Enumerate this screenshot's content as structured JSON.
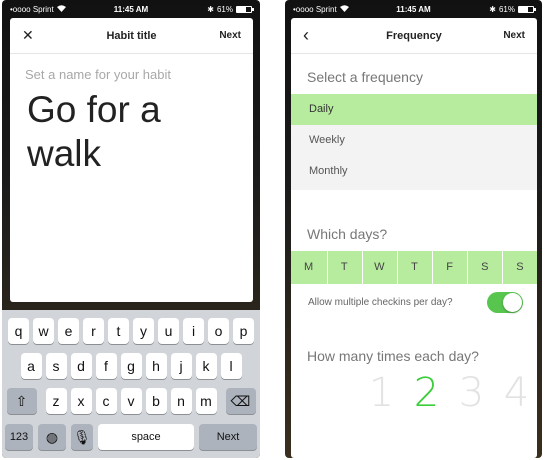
{
  "status_bar": {
    "carrier": "•oooo Sprint",
    "wifi": "wifi-icon",
    "time": "11:45 AM",
    "battery": "61%"
  },
  "left_screen": {
    "nav": {
      "close_icon": "✕",
      "title": "Habit title",
      "next_label": "Next"
    },
    "placeholder": "Set a name for your habit",
    "habit_title": "Go for a walk",
    "keyboard": {
      "row1": [
        "q",
        "w",
        "e",
        "r",
        "t",
        "y",
        "u",
        "i",
        "o",
        "p"
      ],
      "row2": [
        "a",
        "s",
        "d",
        "f",
        "g",
        "h",
        "j",
        "k",
        "l"
      ],
      "row3": [
        "z",
        "x",
        "c",
        "v",
        "b",
        "n",
        "m"
      ],
      "numbers_key": "123",
      "space_key": "space",
      "next_key": "Next"
    }
  },
  "right_screen": {
    "nav": {
      "back_icon": "‹",
      "title": "Frequency",
      "next_label": "Next"
    },
    "frequency_label": "Select a frequency",
    "frequencies": [
      {
        "label": "Daily",
        "selected": true
      },
      {
        "label": "Weekly",
        "selected": false
      },
      {
        "label": "Monthly",
        "selected": false
      }
    ],
    "days_label": "Which days?",
    "days": [
      "M",
      "T",
      "W",
      "T",
      "F",
      "S",
      "S"
    ],
    "multiple_checkins_label": "Allow multiple checkins per day?",
    "multiple_checkins_enabled": true,
    "times_label": "How many times each day?",
    "times_options": [
      "1",
      "2",
      "3",
      "4"
    ],
    "times_selected": "2"
  },
  "colors": {
    "accent_green": "#3ccd3c",
    "selection_green": "#b7ec9f",
    "toggle_green": "#58c54f"
  }
}
